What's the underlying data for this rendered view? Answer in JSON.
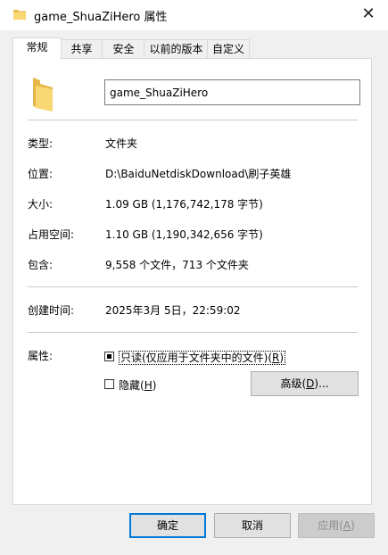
{
  "window": {
    "title": "game_ShuaZiHero 属性",
    "close_symbol": "✕"
  },
  "tabs": [
    {
      "label": "常规",
      "active": true
    },
    {
      "label": "共享",
      "active": false
    },
    {
      "label": "安全",
      "active": false
    },
    {
      "label": "以前的版本",
      "active": false
    },
    {
      "label": "自定义",
      "active": false
    }
  ],
  "general": {
    "name_value": "game_ShuaZiHero",
    "type_label": "类型:",
    "type_value": "文件夹",
    "location_label": "位置:",
    "location_value": "D:\\BaiduNetdiskDownload\\刷子英雄",
    "size_label": "大小:",
    "size_value": "1.09 GB (1,176,742,178 字节)",
    "disk_size_label": "占用空间:",
    "disk_size_value": "1.10 GB (1,190,342,656 字节)",
    "contains_label": "包含:",
    "contains_value": "9,558 个文件，713 个文件夹",
    "created_label": "创建时间:",
    "created_value": "2025年3月 5日，22:59:02",
    "attributes_label": "属性:",
    "readonly_label_pre": "只读(仅应用于文件夹中的文件)(",
    "readonly_hotkey": "R",
    "readonly_label_post": ")",
    "readonly_state": "indeterminate",
    "hidden_label_pre": "隐藏(",
    "hidden_hotkey": "H",
    "hidden_label_post": ")",
    "hidden_checked": false,
    "advanced_label_pre": "高级(",
    "advanced_hotkey": "D",
    "advanced_label_post": ")..."
  },
  "footer": {
    "ok_label": "确定",
    "cancel_label": "取消",
    "apply_label_pre": "应用(",
    "apply_hotkey": "A",
    "apply_label_post": ")"
  },
  "colors": {
    "folder": "#f8d775",
    "folder_dark": "#e6b64a",
    "accent": "#0078d7"
  },
  "icons": {
    "title": "folder-icon",
    "large": "folder-icon"
  }
}
